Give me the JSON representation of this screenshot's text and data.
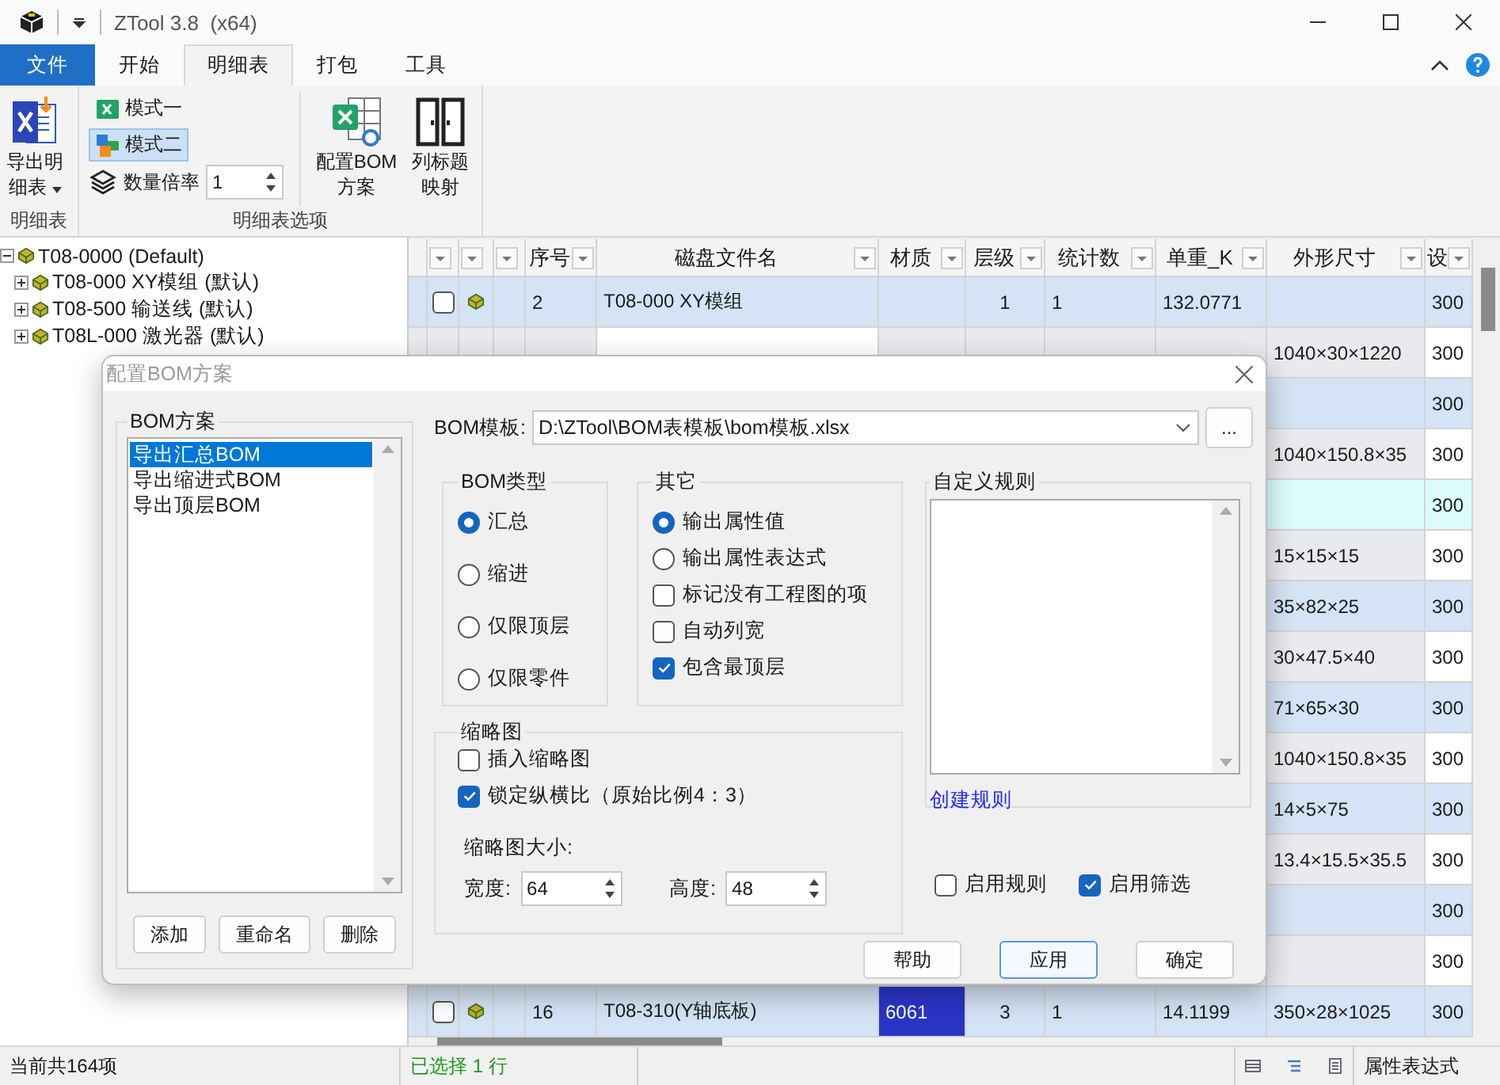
{
  "window": {
    "title": "ZTool 3.8  (x64)"
  },
  "ribbon_tabs": [
    {
      "label": "文件",
      "kind": "file",
      "selected": false
    },
    {
      "label": "开始",
      "kind": "tab",
      "selected": false
    },
    {
      "label": "明细表",
      "kind": "tab",
      "selected": true
    },
    {
      "label": "打包",
      "kind": "tab",
      "selected": false
    },
    {
      "label": "工具",
      "kind": "tab",
      "selected": false
    }
  ],
  "ribbon": {
    "groups": [
      {
        "label": "明细表"
      },
      {
        "label": "明细表选项"
      }
    ],
    "export_button": {
      "label": "导出明细表"
    },
    "modes": [
      {
        "label": "模式一",
        "selected": false
      },
      {
        "label": "模式二",
        "selected": true
      }
    ],
    "multiplier": {
      "label": "数量倍率",
      "value": "1"
    },
    "large_buttons": [
      {
        "label": "配置BOM方案",
        "kind": "bom"
      },
      {
        "label": "列标题映射",
        "kind": "mapping"
      }
    ]
  },
  "tree": [
    {
      "label": "T08-0000 (Default)",
      "expanded": true,
      "children": [
        {
          "label": "T08-000 XY模组 (默认)",
          "expanded": false
        },
        {
          "label": "T08-500 输送线 (默认)",
          "expanded": false
        },
        {
          "label": "T08L-000 激光器 (默认)",
          "expanded": false
        }
      ]
    }
  ],
  "grid": {
    "columns": [
      {
        "label": "序号"
      },
      {
        "label": "磁盘文件名"
      },
      {
        "label": "材质"
      },
      {
        "label": "层级"
      },
      {
        "label": "统计数"
      },
      {
        "label": "单重_K"
      },
      {
        "label": "外形尺寸"
      },
      {
        "label": "设"
      }
    ],
    "rows": [
      {
        "kind": "blue",
        "checked": false,
        "cells": {
          "no": "2",
          "file": "T08-000 XY模组",
          "level": "1",
          "count": "1",
          "weight": "132.0771",
          "design": "300"
        }
      },
      {
        "kind": "plain",
        "cells": {
          "size": "1040×30×1220",
          "design": "300"
        }
      },
      {
        "kind": "blue",
        "cells": {
          "design": "300"
        }
      },
      {
        "kind": "plain",
        "cells": {
          "size": "1040×150.8×35",
          "design": "300"
        }
      },
      {
        "kind": "cyan",
        "cells": {
          "design": "300"
        }
      },
      {
        "kind": "plain",
        "cells": {
          "size": "15×15×15",
          "design": "300"
        }
      },
      {
        "kind": "blue",
        "cells": {
          "size": "35×82×25",
          "design": "300"
        }
      },
      {
        "kind": "plain",
        "cells": {
          "size": "30×47.5×40",
          "design": "300"
        }
      },
      {
        "kind": "blue",
        "cells": {
          "size": "71×65×30",
          "design": "300"
        }
      },
      {
        "kind": "plain",
        "cells": {
          "size": "1040×150.8×35",
          "design": "300"
        }
      },
      {
        "kind": "blue",
        "cells": {
          "size": "14×5×75",
          "design": "300"
        }
      },
      {
        "kind": "plain",
        "cells": {
          "size": "13.4×15.5×35.5",
          "design": "300"
        }
      },
      {
        "kind": "blue",
        "cells": {
          "design": "300"
        }
      },
      {
        "kind": "plain",
        "cells": {
          "design": "300"
        }
      },
      {
        "kind": "blue",
        "checked": false,
        "color": "#2a35c8",
        "cells": {
          "no": "16",
          "file": "T08-310(Y轴底板)",
          "material": "6061",
          "level": "3",
          "count": "1",
          "weight": "14.1199",
          "size": "350×28×1025",
          "design": "300"
        }
      }
    ]
  },
  "dialog": {
    "title": "配置BOM方案",
    "schemes": {
      "title": "BOM方案",
      "items": [
        {
          "label": "导出汇总BOM",
          "selected": true
        },
        {
          "label": "导出缩进式BOM",
          "selected": false
        },
        {
          "label": "导出顶层BOM",
          "selected": false
        }
      ],
      "buttons": [
        {
          "label": "添加"
        },
        {
          "label": "重命名"
        },
        {
          "label": "删除"
        }
      ]
    },
    "template": {
      "label": "BOM模板:",
      "value": "D:\\ZTool\\BOM表模板\\bom模板.xlsx",
      "browse": "..."
    },
    "bom_type": {
      "title": "BOM类型",
      "options": [
        {
          "label": "汇总",
          "selected": true
        },
        {
          "label": "缩进",
          "selected": false
        },
        {
          "label": "仅限顶层",
          "selected": false
        },
        {
          "label": "仅限零件",
          "selected": false
        }
      ]
    },
    "other": {
      "title": "其它",
      "options": [
        {
          "kind": "radio",
          "label": "输出属性值",
          "selected": true
        },
        {
          "kind": "radio",
          "label": "输出属性表达式",
          "selected": false
        },
        {
          "kind": "checkbox",
          "label": "标记没有工程图的项",
          "checked": false
        },
        {
          "kind": "checkbox",
          "label": "自动列宽",
          "checked": false
        },
        {
          "kind": "checkbox",
          "label": "包含最顶层",
          "checked": true
        }
      ]
    },
    "thumbnail": {
      "title": "缩略图",
      "options": [
        {
          "label": "插入缩略图",
          "checked": false
        },
        {
          "label": "锁定纵横比（原始比例4：3）",
          "checked": true
        }
      ],
      "size_label": "缩略图大小:",
      "width": {
        "label": "宽度:",
        "value": "64"
      },
      "height": {
        "label": "高度:",
        "value": "48"
      }
    },
    "custom_rules": {
      "title": "自定义规则",
      "link": "创建规则"
    },
    "toggles": [
      {
        "label": "启用规则",
        "checked": false
      },
      {
        "label": "启用筛选",
        "checked": true
      }
    ],
    "buttons": [
      {
        "label": "帮助",
        "focused": false
      },
      {
        "label": "应用",
        "focused": true
      },
      {
        "label": "确定",
        "focused": false
      }
    ]
  },
  "status_bar": {
    "count": "当前共164项",
    "selection": "已选择 1 行",
    "mode": "属性表达式"
  }
}
